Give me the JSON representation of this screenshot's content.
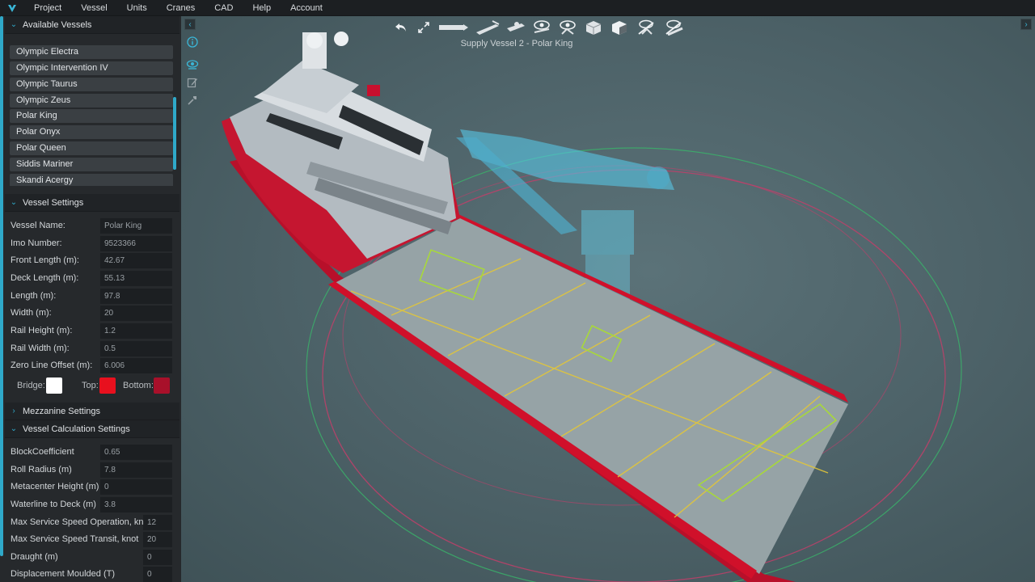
{
  "menu": {
    "items": [
      "Project",
      "Vessel",
      "Units",
      "Cranes",
      "CAD",
      "Help",
      "Account"
    ]
  },
  "vessels_section": {
    "title": "Available Vessels",
    "items": [
      "Olympic Electra",
      "Olympic Intervention IV",
      "Olympic Taurus",
      "Olympic Zeus",
      "Polar King",
      "Polar Onyx",
      "Polar Queen",
      "Siddis Mariner",
      "Skandi Acergy"
    ]
  },
  "vessel_settings": {
    "title": "Vessel Settings",
    "fields": [
      {
        "label": "Vessel Name:",
        "value": "Polar King"
      },
      {
        "label": "Imo Number:",
        "value": "9523366"
      },
      {
        "label": "Front Length (m):",
        "value": "42.67"
      },
      {
        "label": "Deck Length (m):",
        "value": "55.13"
      },
      {
        "label": "Length (m):",
        "value": "97.8"
      },
      {
        "label": "Width (m):",
        "value": "20"
      },
      {
        "label": "Rail Height (m):",
        "value": "1.2"
      },
      {
        "label": "Rail Width (m):",
        "value": "0.5"
      },
      {
        "label": "Zero Line Offset (m):",
        "value": "6.006"
      }
    ],
    "colors": {
      "bridge_label": "Bridge:",
      "bridge_color": "#ffffff",
      "top_label": "Top:",
      "top_color": "#e8101e",
      "bottom_label": "Bottom:",
      "bottom_color": "#a8102a"
    }
  },
  "mezzanine_settings": {
    "title": "Mezzanine Settings"
  },
  "calc_settings": {
    "title": "Vessel Calculation Settings",
    "fields": [
      {
        "label": "BlockCoefficient",
        "value": "0.65"
      },
      {
        "label": "Roll Radius (m)",
        "value": "7.8"
      },
      {
        "label": "Metacenter Height (m)",
        "value": "0"
      },
      {
        "label": "Waterline to Deck (m)",
        "value": "3.8"
      },
      {
        "label": "Max Service Speed Operation, knot",
        "value": "12"
      },
      {
        "label": "Max Service Speed Transit, knot",
        "value": "20"
      },
      {
        "label": "Draught (m)",
        "value": "0"
      },
      {
        "label": "Displacement Moulded (T)",
        "value": "0"
      }
    ]
  },
  "viewport": {
    "title": "Supply Vessel 2 - Polar King"
  },
  "icons": {
    "logo": "app-logo-icon",
    "toolbar": [
      "undo-icon",
      "expand-icon",
      "ruler-icon",
      "measure-icon",
      "deck-view-icon",
      "eye-deck-icon",
      "eye-crane-icon",
      "box-view-icon",
      "box-half-icon",
      "hide-crane-icon",
      "hide-ruler-icon"
    ],
    "side": [
      "info-icon",
      "visibility-icon",
      "edit-icon",
      "tools-icon"
    ]
  },
  "theme": {
    "accent": "#2fa9c9",
    "hull_red": "#c8102e",
    "deck_grey": "#8d9a9c",
    "crane_blue": "#56c6e8"
  }
}
